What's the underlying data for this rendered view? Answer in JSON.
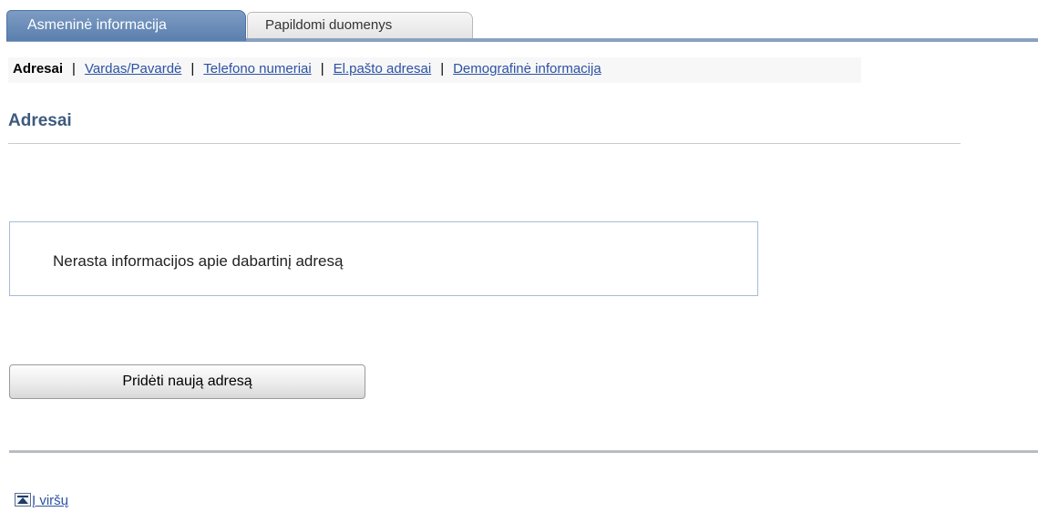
{
  "tabs": [
    {
      "label": "Asmeninė informacija",
      "active": true
    },
    {
      "label": "Papildomi duomenys",
      "active": false
    }
  ],
  "subnav": {
    "current": "Adresai",
    "links": [
      "Vardas/Pavardė",
      "Telefono numeriai",
      "El.pašto adresai",
      "Demografinė informacija"
    ],
    "separator": "|"
  },
  "page_title": "Adresai",
  "info_message": "Nerasta informacijos apie dabartinį adresą",
  "add_button_label": "Pridėti naują adresą",
  "back_to_top": {
    "label": "Į viršų",
    "icon": "arrow-up-to-top-icon"
  },
  "colors": {
    "accent": "#5a7fae",
    "link": "#2c52a3",
    "title": "#3e5a7e"
  }
}
